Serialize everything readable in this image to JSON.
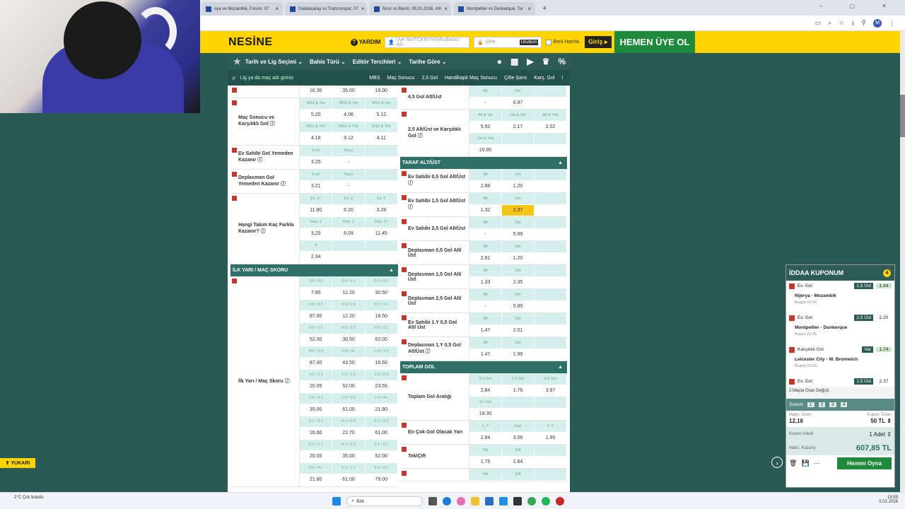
{
  "browser": {
    "tabs": [
      "oya ve Mozambik, Forum, 07",
      "Galatasaray vs Trabzonspor, 07",
      "Mısır vs Benin, 05.01.2026, Afri",
      "Montpellier vs Dunkerque, Tur"
    ],
    "close": "×",
    "newtab": "+",
    "profile": "M",
    "window_controls": "– ▢ ✕"
  },
  "header": {
    "logo": "NESİNE",
    "help": "YARDIM",
    "help_icon": "?",
    "user_placeholder": "Üye No/TCKN/YKN/Kullanıcı Adı",
    "password_placeholder": "Şifre",
    "forgot": "Unuttum",
    "remember": "Beni Hatırla",
    "login": "Giriş ▸",
    "signup": "HEMEN ÜYE OL"
  },
  "nav": {
    "items": [
      "Tarih ve Lig Seçimi ⌄",
      "Bahis Türü ⌄",
      "Editör Tercihleri ⌄",
      "Tarihe Göre ⌄"
    ],
    "icons": [
      "●",
      "▦",
      "▶",
      "♛",
      "%"
    ]
  },
  "search": {
    "placeholder": "Lig ya da maç adı giriniz",
    "headers": [
      "MBS",
      "Maç Sonucu",
      "2,5 Gol",
      "Handikaplı Maç Sonucu",
      "Çifte Şans",
      "Karş. Gol",
      "i"
    ]
  },
  "left": [
    {
      "type": "market",
      "label": "",
      "rows": [
        {
          "c": [
            "16.30",
            "35.00",
            "16.00"
          ],
          "h": false
        }
      ]
    },
    {
      "type": "market",
      "label": "Maç Sonucu ve Karşılıklı Gol ⓘ",
      "rows": [
        {
          "c": [
            "MS1 & Var",
            "MSX & Var",
            "MS2 & Var"
          ],
          "h": true
        },
        {
          "c": [
            "5.20",
            "4.06",
            "5.12"
          ],
          "h": false
        },
        {
          "c": [
            "MS1 & Yok",
            "MSX & Yok",
            "MS2 & Yok"
          ],
          "h": true
        },
        {
          "c": [
            "4.18",
            "9.12",
            "4.11"
          ],
          "h": false
        }
      ]
    },
    {
      "type": "market",
      "label": "Ev Sahibi Gol Yemeden Kazanır ⓘ",
      "rows": [
        {
          "c": [
            "Evet",
            "Hayır",
            ""
          ],
          "h": true
        },
        {
          "c": [
            "3.25",
            "-",
            ""
          ],
          "h": false
        }
      ]
    },
    {
      "type": "market",
      "label": "Deplasman Gol Yemeden Kazanır ⓘ",
      "rows": [
        {
          "c": [
            "Evet",
            "Hayır",
            ""
          ],
          "h": true
        },
        {
          "c": [
            "3.21",
            "-",
            ""
          ],
          "h": false
        }
      ]
    },
    {
      "type": "market",
      "label": "Hangi Takım Kaç Farkla Kazanır? ⓘ",
      "rows": [
        {
          "c": [
            "Ev. 3+",
            "Ev. 2",
            "Ev. 1"
          ],
          "h": true
        },
        {
          "c": [
            "11.80",
            "6.20",
            "3.28"
          ],
          "h": false
        },
        {
          "c": [
            "Dep. 1",
            "Dep. 2",
            "Dep. 3+"
          ],
          "h": true
        },
        {
          "c": [
            "3.25",
            "6.09",
            "11.45"
          ],
          "h": false
        },
        {
          "c": [
            "0",
            "",
            ""
          ],
          "h": true
        },
        {
          "c": [
            "2.34",
            "",
            ""
          ],
          "h": false
        }
      ]
    },
    {
      "type": "section",
      "label": "İLK YARI / MAÇ SKORU",
      "arrow": "▲"
    },
    {
      "type": "market",
      "label": "İlk Yarı / Maç Skoru ⓘ",
      "rows": [
        {
          "c": [
            "0:0 / 0:0",
            "0:0 / 0:1",
            "0:0 / 0:2"
          ],
          "h": true
        },
        {
          "c": [
            "7.85",
            "12.20",
            "30.50"
          ],
          "h": false
        },
        {
          "c": [
            "0:0 / 0:3",
            "0:0 / 1:0",
            "0:0 / 1:1"
          ],
          "h": true
        },
        {
          "c": [
            "87.00",
            "12.20",
            "16.50"
          ],
          "h": false
        },
        {
          "c": [
            "0:0 / 1:2",
            "0:0 / 2:0",
            "0:0 / 2:1"
          ],
          "h": true
        },
        {
          "c": [
            "52.00",
            "30.50",
            "52.00"
          ],
          "h": false
        },
        {
          "c": [
            "0:0 / 3:0",
            "0:0 / 4+",
            "1:0 / 1:0"
          ],
          "h": true
        },
        {
          "c": [
            "87.00",
            "43.50",
            "16.60"
          ],
          "h": false
        },
        {
          "c": [
            "1:0 / 1:1",
            "1:0 / 1:2",
            "1:0 / 2:0"
          ],
          "h": true
        },
        {
          "c": [
            "20.05",
            "52.00",
            "23.55"
          ],
          "h": false
        },
        {
          "c": [
            "1:0 / 2:1",
            "1:0 / 3:0",
            "1:0 / 4+"
          ],
          "h": true
        },
        {
          "c": [
            "35.00",
            "61.00",
            "21.80"
          ],
          "h": false
        },
        {
          "c": [
            "0:1 / 0:1",
            "0:1 / 0:2",
            "0:1 / 0:3"
          ],
          "h": true
        },
        {
          "c": [
            "16.60",
            "22.70",
            "61.00"
          ],
          "h": false
        },
        {
          "c": [
            "0:1 / 1:1",
            "0:1 / 1:2",
            "0:1 / 2:1"
          ],
          "h": true
        },
        {
          "c": [
            "20.05",
            "35.00",
            "52.00"
          ],
          "h": false
        },
        {
          "c": [
            "0:1 / 4+",
            "1:1 / 1:1",
            "2:0 / 2:1"
          ],
          "h": true
        },
        {
          "c": [
            "21.80",
            "61.00",
            "79.00"
          ],
          "h": false
        }
      ]
    }
  ],
  "right": [
    {
      "type": "market",
      "label": "4,5 Gol Alt/Üst",
      "rows": [
        {
          "c": [
            "Alt",
            "Üst",
            ""
          ],
          "h": true
        },
        {
          "c": [
            "-",
            "6.97",
            ""
          ],
          "h": false
        }
      ]
    },
    {
      "type": "market",
      "label": "2,5 Alt/Üst ve Karşılıklı Gol ⓘ",
      "rows": [
        {
          "c": [
            "Alt & Var",
            "Üst & Var",
            "Alt & Yok"
          ],
          "h": true
        },
        {
          "c": [
            "5.92",
            "2.17",
            "2.02"
          ],
          "h": false
        },
        {
          "c": [
            "Üst & Yok",
            "",
            ""
          ],
          "h": true
        },
        {
          "c": [
            "10.90",
            "",
            ""
          ],
          "h": false
        }
      ]
    },
    {
      "type": "section",
      "label": "TARAF ALT/ÜST",
      "arrow": "▲"
    },
    {
      "type": "market",
      "label": "Ev Sahibi 0,5 Gol Alt/Üst ⓘ",
      "rows": [
        {
          "c": [
            "Alt",
            "Üst",
            ""
          ],
          "h": true
        },
        {
          "c": [
            "2.88",
            "1.20",
            ""
          ],
          "h": false
        }
      ]
    },
    {
      "type": "market",
      "label": "Ev Sahibi 1,5 Gol Alt/Üst ⓘ",
      "rows": [
        {
          "c": [
            "Alt",
            "Üst",
            ""
          ],
          "h": true
        },
        {
          "c": [
            "1.32",
            "2.37",
            ""
          ],
          "h": false,
          "sel": 1
        }
      ]
    },
    {
      "type": "market",
      "label": "Ev Sahibi 2,5 Gol Alt/Üst",
      "rows": [
        {
          "c": [
            "Alt",
            "Üst",
            ""
          ],
          "h": true
        },
        {
          "c": [
            "-",
            "5.99",
            ""
          ],
          "h": false
        }
      ]
    },
    {
      "type": "market",
      "label": "Deplasman 0,5 Gol Alt/ Üst",
      "rows": [
        {
          "c": [
            "Alt",
            "Üst",
            ""
          ],
          "h": true
        },
        {
          "c": [
            "2.91",
            "1.20",
            ""
          ],
          "h": false
        }
      ]
    },
    {
      "type": "market",
      "label": "Deplasman 1,5 Gol Alt/ Üst",
      "rows": [
        {
          "c": [
            "Alt",
            "Üst",
            ""
          ],
          "h": true
        },
        {
          "c": [
            "1.33",
            "2.35",
            ""
          ],
          "h": false
        }
      ]
    },
    {
      "type": "market",
      "label": "Deplasman 2,5 Gol Alt/ Üst",
      "rows": [
        {
          "c": [
            "Alt",
            "Üst",
            ""
          ],
          "h": true
        },
        {
          "c": [
            "-",
            "5.89",
            ""
          ],
          "h": false
        }
      ]
    },
    {
      "type": "market",
      "label": "Ev Sahibi 1.Y 0,5 Gol Alt/ Üst",
      "rows": [
        {
          "c": [
            "Alt",
            "Üst",
            ""
          ],
          "h": true
        },
        {
          "c": [
            "1.47",
            "2.01",
            ""
          ],
          "h": false
        }
      ]
    },
    {
      "type": "market",
      "label": "Deplasman 1.Y 0,5 Gol Alt/Üst ⓘ",
      "rows": [
        {
          "c": [
            "Alt",
            "Üst",
            ""
          ],
          "h": true
        },
        {
          "c": [
            "1.47",
            "1.99",
            ""
          ],
          "h": false
        }
      ]
    },
    {
      "type": "section",
      "label": "TOPLAM GOL",
      "arrow": "▲"
    },
    {
      "type": "market",
      "label": "Toplam Gol Aralığı",
      "rows": [
        {
          "c": [
            "0-1 Gol",
            "2-3 Gol",
            "4-5 Gol"
          ],
          "h": true
        },
        {
          "c": [
            "2.84",
            "1.76",
            "3.97"
          ],
          "h": false
        },
        {
          "c": [
            "6+ Gol",
            "",
            ""
          ],
          "h": true
        },
        {
          "c": [
            "18.30",
            "",
            ""
          ],
          "h": false
        }
      ]
    },
    {
      "type": "market",
      "label": "En Çok Gol Olacak Yarı",
      "rows": [
        {
          "c": [
            "1. Y",
            "Eşit",
            "2. Y"
          ],
          "h": true
        },
        {
          "c": [
            "2.94",
            "3.06",
            "1.95"
          ],
          "h": false
        }
      ]
    },
    {
      "type": "market",
      "label": "Tek/Çift",
      "rows": [
        {
          "c": [
            "Tek",
            "Çift",
            ""
          ],
          "h": true
        },
        {
          "c": [
            "1.75",
            "1.64",
            ""
          ],
          "h": false
        }
      ]
    },
    {
      "type": "market",
      "label": "",
      "rows": [
        {
          "c": [
            "Tek",
            "Çift",
            ""
          ],
          "h": true
        }
      ]
    }
  ],
  "coupon": {
    "title": "İDDAA KUPONUM",
    "count": "4",
    "rows": [
      {
        "kind": "pick",
        "market": "Ev. Gol",
        "pick": "1,5 Üst",
        "odd": "1.34",
        "green": true
      },
      {
        "kind": "match",
        "name": "Nijerya - Mozambik",
        "time": "Bugün 22:00"
      },
      {
        "kind": "pick",
        "market": "Ev. Gol",
        "pick": "2,5 Üst",
        "odd": "2.20",
        "green": false
      },
      {
        "kind": "match",
        "name": "Montpellier - Dunkerque",
        "time": "Bugün 22:45"
      },
      {
        "kind": "pick",
        "market": "Karşılıklı Gol",
        "pick": "Var",
        "odd": "1.74",
        "green": true
      },
      {
        "kind": "match",
        "name": "Leicester City - W. Bromwich",
        "time": "Bugün 23:00"
      },
      {
        "kind": "pick",
        "market": "Ev. Gol",
        "pick": "1,5 Üst",
        "odd": "2.37",
        "green": false
      }
    ],
    "note": "2 Maçta Oran Değişti.",
    "system_label": "Sistem",
    "system": [
      "1",
      "2",
      "3",
      "4"
    ],
    "max_odd_label": "Maks. Oran",
    "max_odd": "12,16",
    "amount_label": "Kupon Tutarı",
    "amount": "50 TL ⇕",
    "count_label": "Kupon Adedi",
    "count_val": "1 Adet ⇕",
    "max_win_label": "Maks. Kazanç",
    "max_win": "607,85 TL",
    "play": "Hemen Oyna",
    "bottom_icons": [
      "🗑",
      "💾",
      "⋯"
    ]
  },
  "top_button": "YUKARI",
  "side_arrow": "›",
  "taskbar": {
    "weather": "2°C Çok bulutlu",
    "search": "Ara",
    "time": "19:59",
    "date": "5.01.2026"
  }
}
